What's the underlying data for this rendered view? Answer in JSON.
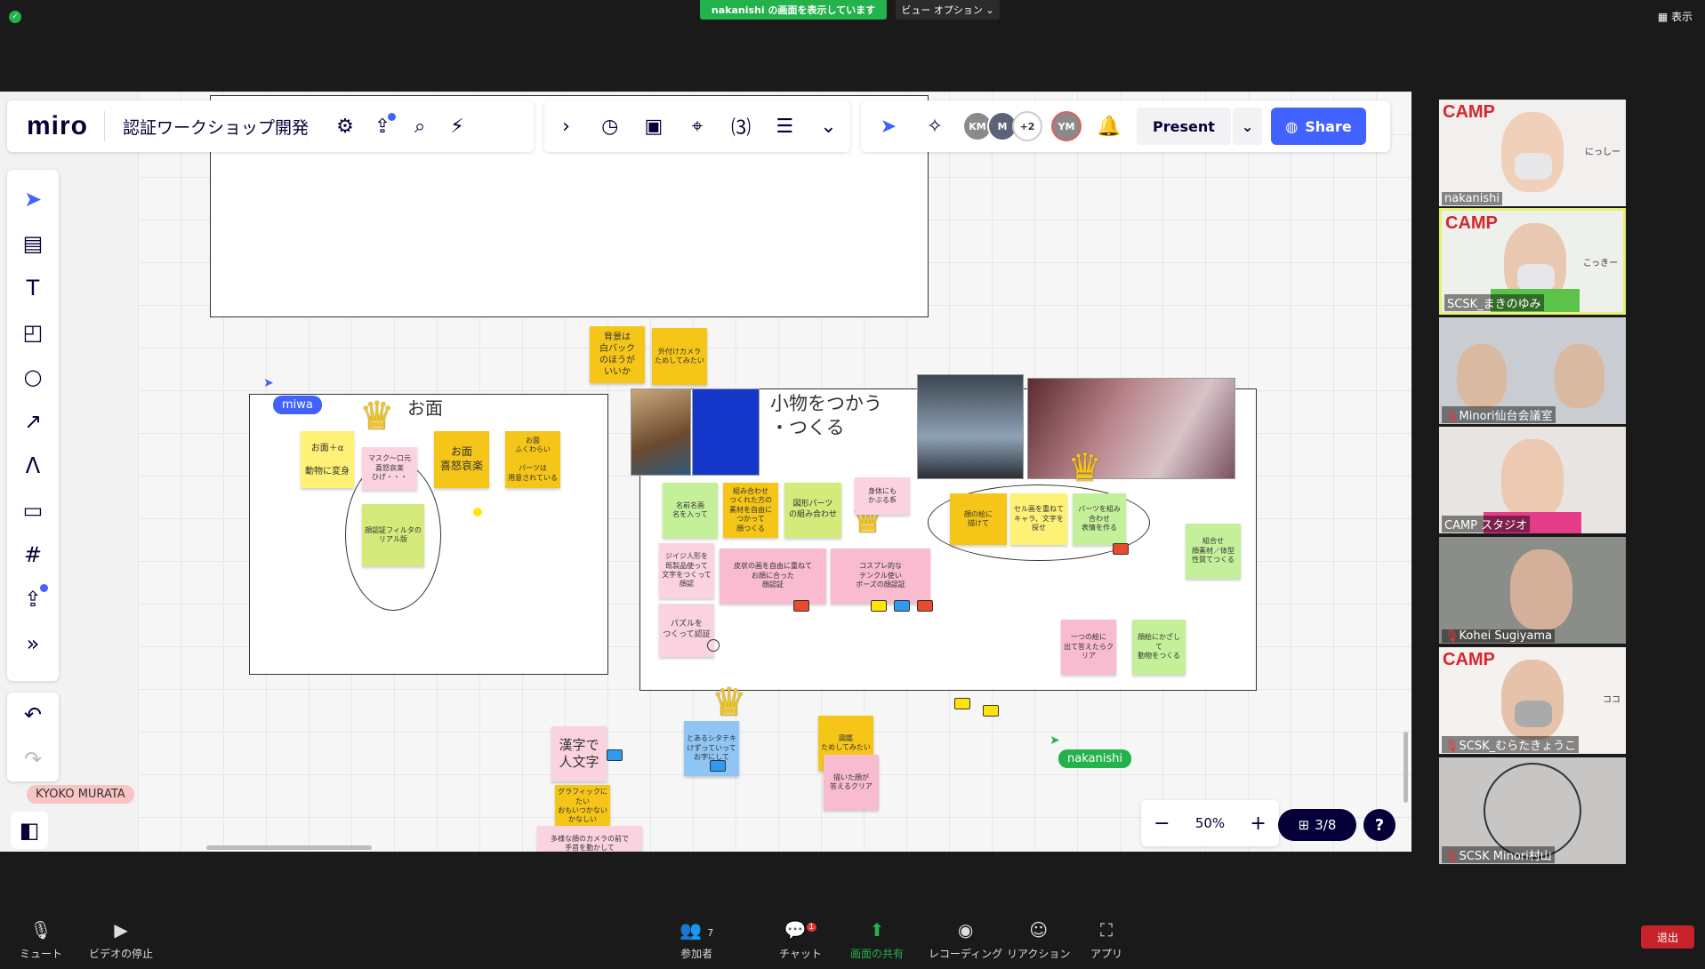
{
  "zoom_top": {
    "share_banner": "nakanishi の画面を表示しています",
    "view_options": "ビュー オプション ⌄",
    "display_label": "表示"
  },
  "miro": {
    "logo": "miro",
    "board_name": "認証ワークショップ開発",
    "present_label": "Present",
    "share_label": "Share",
    "avatars": [
      "KM",
      "M",
      "+2",
      "YM"
    ],
    "zoom_level": "50%",
    "page_indicator": "3/8",
    "help": "?",
    "users": {
      "miwa": "miwa",
      "nakanishi": "nakanishi",
      "kyoko": "KYOKO MURATA"
    }
  },
  "canvas": {
    "frame1_title": "お面",
    "frame2_title": "小物をつかう\n・つくる",
    "notes": {
      "bg_white": "背景は\n白バック\nのほうが\nいいか",
      "outside_camera": "外付けカメラ\nためしてみたい",
      "omen_a": "お面＋α\n\n動物に変身",
      "omen_mask": "マスク～口元\n喜怒哀楽\nひげ・・・",
      "omen_kido": "お面\n喜怒哀楽",
      "omen_fuku": "お面\nふくわらい\n\nパーツは\n用意されている",
      "omen_filter": "顔認証フィルタの\nリアル版",
      "k_name": "名前名画\n名を入って",
      "k_combo": "組み合わせ\nつくれた方の\n素材を自由に\nつかって\n顔つくる",
      "k_parts": "図形パーツ\nの組み合わせ",
      "k_pose": "身体にも\nかぶる系",
      "k_1": "ジイジ人形を\n既製品使って\n文字をつくって顔認",
      "k_2": "皮状の画を自由に重ねて\nお顔に合った\n顔認証",
      "k_3": "コスプレ的な\nテンクル使い\nポーズの顔認証",
      "k_puzzle": "パズルを\nつくって認証",
      "k_cel": "セル画を重ねて\nキャラ、文字を\n探せ",
      "k_4": "パーツを組み合わせ\n表情を作る",
      "k_5": "顔の絵に\n描けて",
      "k_right": "組合せ\n顔素材／体型\n性質てつくる",
      "k_draw": "一つの絵に\n出て答えたらクリア",
      "k_g2": "顔絵にかざして\n動物をつくる",
      "kanji": "漢字で\n人文字",
      "kanji_sub": "グラフィックにたい\nおもいつかない\nかなしい",
      "kanji_sub2": "多様な顔のカメラの前で\n手首を動かして",
      "blue": "とあるシタテキ\nけずっていって\nお字にして",
      "try_draw": "図鑑\nためしてみたい",
      "pink_bottom": "描いた顔が\n答えるクリア"
    }
  },
  "participants": [
    {
      "name": "nakanishi",
      "camp": "CAMP",
      "sign": "にっしー"
    },
    {
      "name": "SCSK_まきのゆみ",
      "camp": "CAMP",
      "sign": "こっきー"
    },
    {
      "name": "Minori仙台会議室",
      "camp": "",
      "sign": ""
    },
    {
      "name": "CAMP スタジオ",
      "camp": "",
      "sign": ""
    },
    {
      "name": "Kohei Sugiyama",
      "camp": "",
      "sign": ""
    },
    {
      "name": "SCSK_むらたきょうこ",
      "camp": "CAMP",
      "sign": "ココ"
    },
    {
      "name": "SCSK Minori村山",
      "camp": "",
      "sign": ""
    }
  ],
  "zoom_bottom": {
    "mute": "ミュート",
    "video": "ビデオの停止",
    "participants": "参加者",
    "participants_count": "7",
    "chat": "チャット",
    "chat_badge": "1",
    "share": "画面の共有",
    "record": "レコーディング",
    "reaction": "リアクション",
    "apps": "アプリ",
    "leave": "退出"
  },
  "colors": {
    "miro_blue": "#4262ff",
    "zoom_green": "#23b24b",
    "leave_red": "#c8222b"
  }
}
